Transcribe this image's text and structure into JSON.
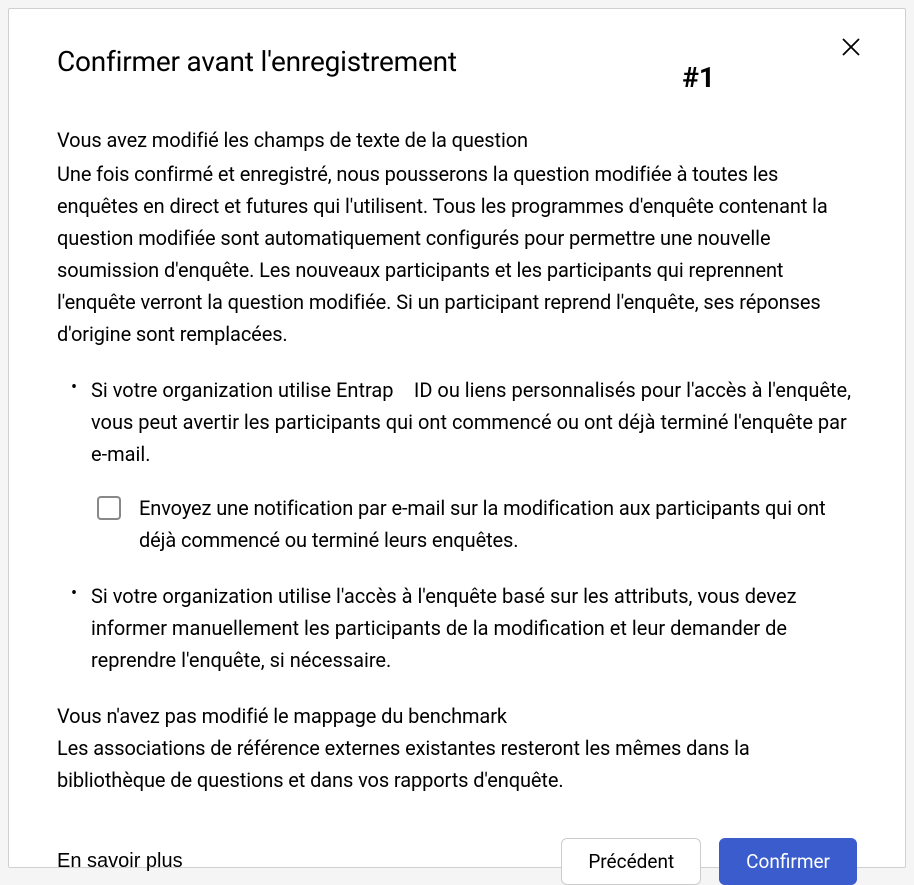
{
  "dialog": {
    "title": "Confirmer avant l'enregistrement",
    "hash": "#1"
  },
  "section1": {
    "heading": "Vous avez modifié les champs de texte de la question",
    "para": "Une fois confirmé et enregistré, nous pousserons la question modifiée à toutes les enquêtes en direct et futures qui l'utilisent. Tous les programmes d'enquête contenant la question modifiée sont automatiquement configurés pour permettre une nouvelle soumission d'enquête. Les nouveaux participants et les participants qui reprennent l'enquête verront la question modifiée. Si un participant reprend l'enquête, ses réponses d'origine sont remplacées.",
    "bullet1": "Si votre organization utilise Entrap ID ou liens personnalisés pour l'accès à l'enquête, vous peut avertir les participants qui ont commencé ou ont déjà terminé l'enquête par e-mail.",
    "checkbox_label": "Envoyez une notification par e-mail sur la modification aux participants qui ont déjà commencé ou terminé leurs enquêtes.",
    "bullet2": "Si votre organization utilise l'accès à l'enquête basé sur les attributs, vous devez informer manuellement les participants de la modification et leur demander de reprendre l'enquête, si nécessaire."
  },
  "section2": {
    "heading": "Vous n'avez pas modifié le mappage du benchmark",
    "para": "Les associations de référence externes existantes resteront les mêmes dans la bibliothèque de questions et dans vos rapports d'enquête."
  },
  "footer": {
    "learn_more": "En savoir plus",
    "previous": "Précédent",
    "confirm": "Confirmer"
  }
}
